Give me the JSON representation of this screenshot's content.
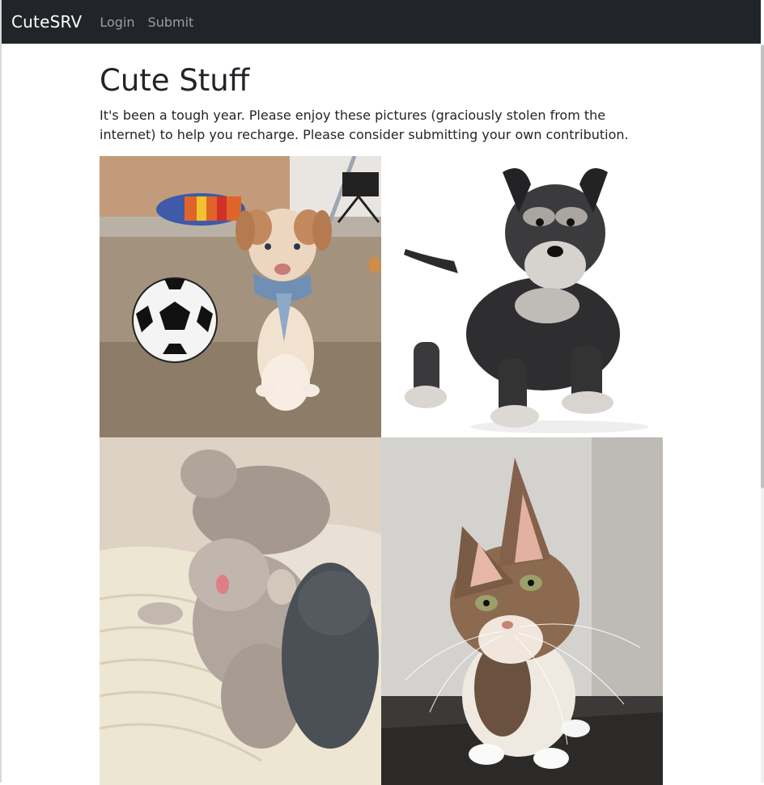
{
  "navbar": {
    "brand": "CuteSRV",
    "links": [
      "Login",
      "Submit"
    ],
    "background": "#212529"
  },
  "main": {
    "title": "Cute Stuff",
    "intro": "It's been a tough year. Please enjoy these pictures (graciously stolen from the internet) to help you recharge. Please consider submitting your own contribution."
  },
  "gallery": {
    "images": [
      {
        "subject": "puppy-with-soccer-ball"
      },
      {
        "subject": "schnauzer-puppy"
      },
      {
        "subject": "sleeping-kittens"
      },
      {
        "subject": "maine-coon-kitten"
      }
    ]
  }
}
